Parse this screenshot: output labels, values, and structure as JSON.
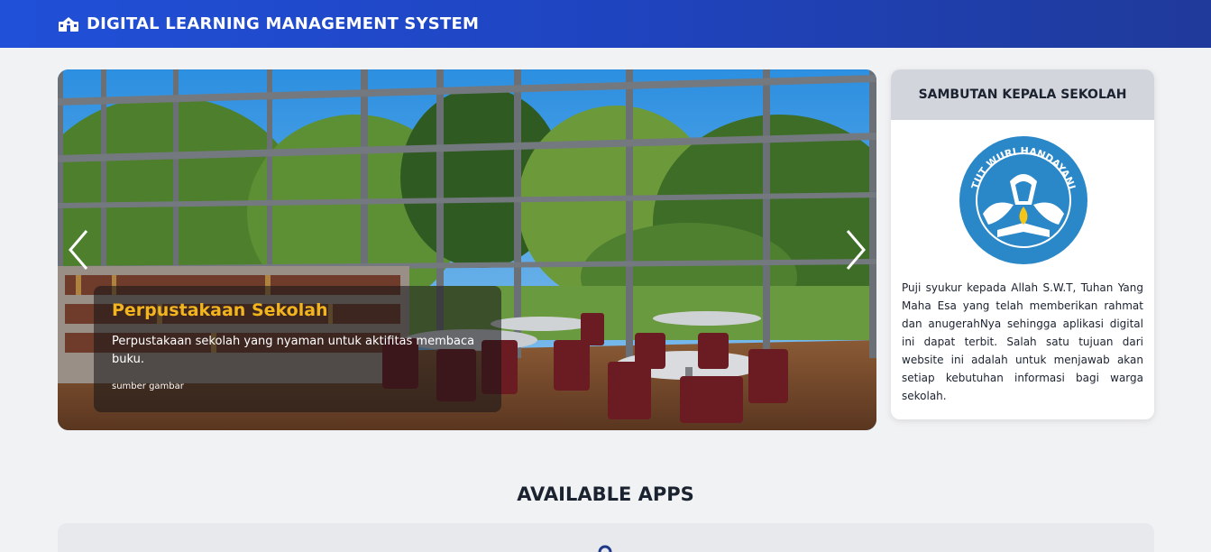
{
  "navbar": {
    "title": "DIGITAL LEARNING MANAGEMENT SYSTEM",
    "icon": "school-icon"
  },
  "carousel": {
    "slide_title": "Perpustakaan Sekolah",
    "slide_description": "Perpustakaan sekolah yang nyaman untuk aktifitas membaca buku.",
    "slide_source": "sumber gambar",
    "prev_icon": "chevron-left-icon",
    "next_icon": "chevron-right-icon"
  },
  "welcome": {
    "heading": "SAMBUTAN KEPALA SEKOLAH",
    "logo_text": "TUT WURI HANDAYANI",
    "message": "Puji syukur kepada Allah S.W.T, Tuhan Yang Maha Esa yang telah memberikan rahmat dan anugerahNya sehingga aplikasi digital ini dapat terbit. Salah satu tujuan dari website ini adalah untuk menjawab akan setiap kebutuhan informasi bagi warga sekolah."
  },
  "apps": {
    "heading": "AVAILABLE APPS"
  },
  "colors": {
    "navbar_start": "#2050d8",
    "navbar_end": "#1f3a9a",
    "caption_title": "#f2b51e",
    "card_header": "#d3d5dc",
    "page_bg": "#f1f2f4"
  }
}
